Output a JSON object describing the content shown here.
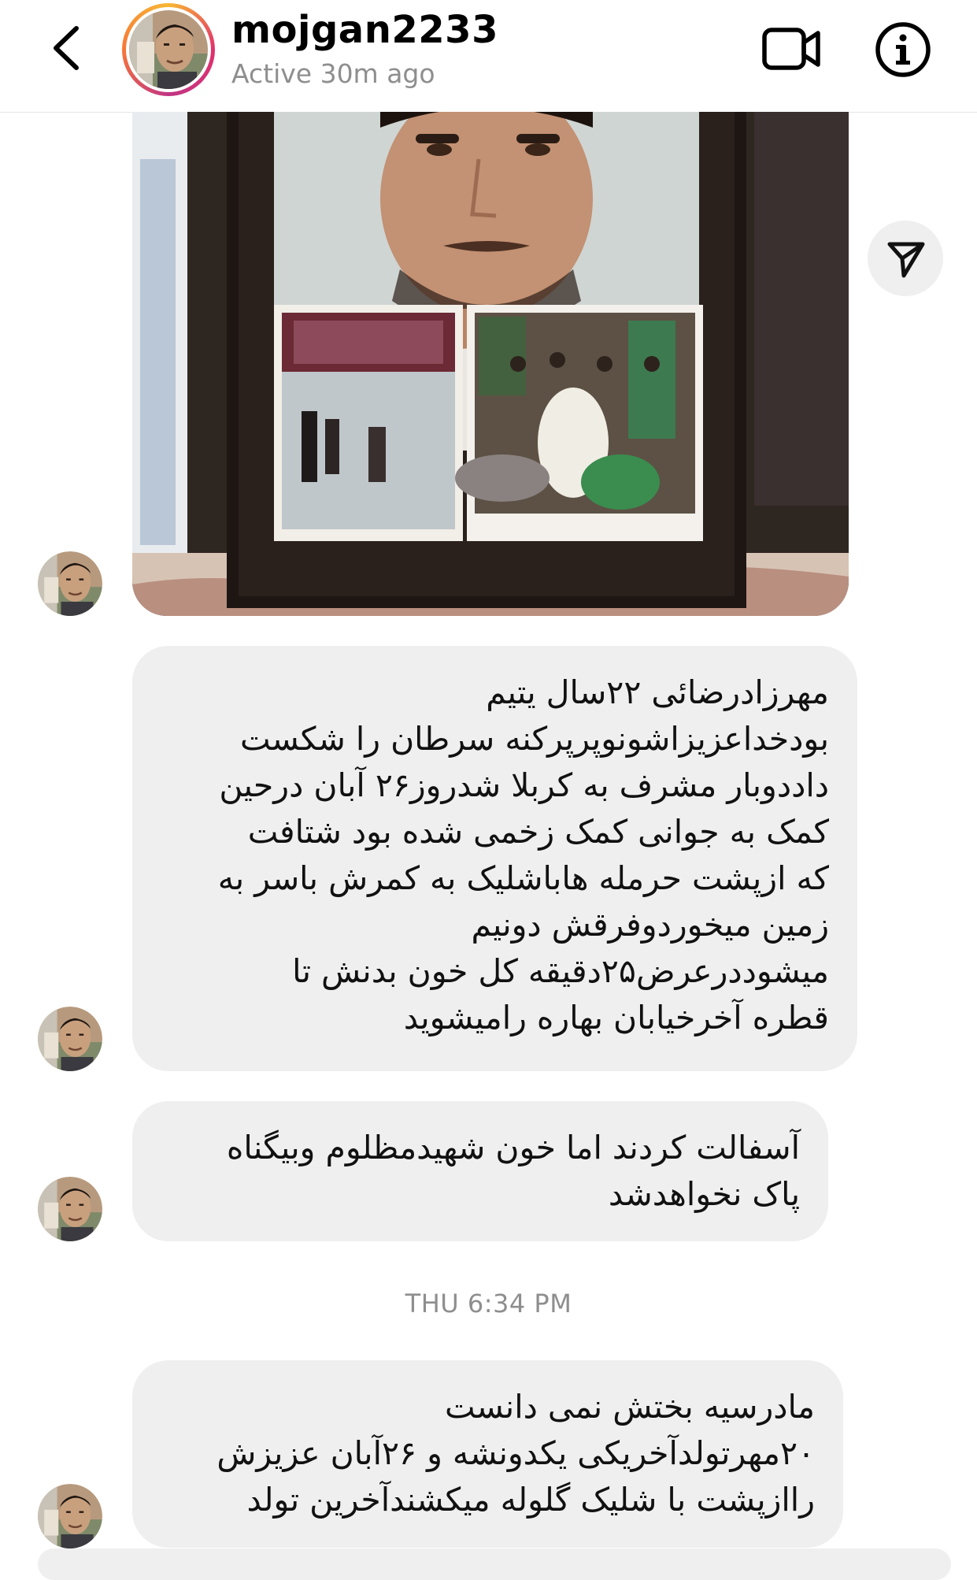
{
  "header": {
    "username": "mojgan2233",
    "status": "Active 30m ago"
  },
  "icons": {
    "back": "chevron-left-icon",
    "video": "video-call-icon",
    "info": "info-icon",
    "share": "send-icon"
  },
  "messages": [
    {
      "lines": [
        "مهرزادرضائی ۲۲سال یتیم",
        "بودخداعزیزاشونوپرپرکنه سرطان را شکست",
        "داددوبار مشرف به کربلا شدروز۲۶ آبان درحین",
        "کمک به جوانی کمک زخمی شده بود شتافت",
        "که ازپشت حرمله هاباشلیک به کمرش باسر به",
        "زمین میخوردوفرقش دونیم",
        "میشوددرعرض۲۵دقیقه کل خون بدنش تا",
        "قطره آخرخیابان بهاره رامیشوید"
      ]
    },
    {
      "lines": [
        "آسفالت کردند اما خون شهیدمظلوم وبیگناه",
        "پاک نخواهدشد"
      ]
    },
    {
      "lines": [
        "مادرسیه بختش نمی دانست",
        "۲۰مهرتولدآخریکی یکدونشه و ۲۶آبان عزیزش",
        "راازپشت با شلیک گلوله میکشندآخرین تولد"
      ]
    }
  ],
  "divider": {
    "time": "THU 6:34 PM"
  }
}
